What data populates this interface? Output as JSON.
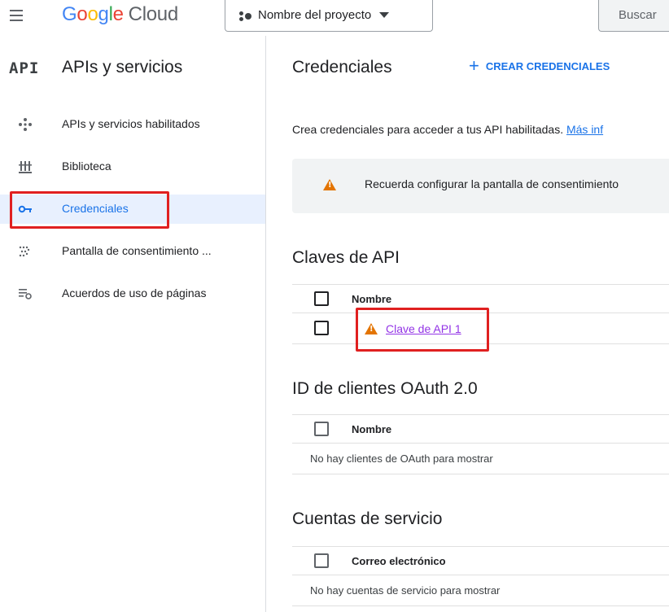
{
  "header": {
    "logo": {
      "google_letters": [
        "G",
        "o",
        "o",
        "g",
        "l",
        "e"
      ],
      "cloud_word": "Cloud"
    },
    "project_picker_label": "Nombre del proyecto",
    "search_placeholder": "Buscar",
    "icons": {
      "menu": "hamburger-menu-icon",
      "project": "project-nodes-icon",
      "caret": "caret-down-icon"
    }
  },
  "sidebar": {
    "badge": "API",
    "title": "APIs y servicios",
    "items": [
      {
        "label": "APIs y servicios habilitados",
        "icon": "dashboard-diamond-icon",
        "active": false
      },
      {
        "label": "Biblioteca",
        "icon": "library-icon",
        "active": false
      },
      {
        "label": "Credenciales",
        "icon": "key-icon",
        "active": true
      },
      {
        "label": "Pantalla de consentimiento ...",
        "icon": "consent-dots-icon",
        "active": false
      },
      {
        "label": "Acuerdos de uso de páginas",
        "icon": "settings-list-icon",
        "active": false
      }
    ]
  },
  "main": {
    "title": "Credenciales",
    "create_button": "CREAR CREDENCIALES",
    "intro_text": "Crea credenciales para acceder a tus API habilitadas.",
    "intro_link": "Más inf",
    "warning_text": "Recuerda configurar la pantalla de consentimiento",
    "api_keys": {
      "title": "Claves de API",
      "column_name": "Nombre",
      "rows": [
        {
          "name": "Clave de API 1",
          "warning": true
        }
      ]
    },
    "oauth_clients": {
      "title": "ID de clientes OAuth 2.0",
      "column_name": "Nombre",
      "empty_text": "No hay clientes de OAuth para mostrar"
    },
    "service_accounts": {
      "title": "Cuentas de servicio",
      "column_email": "Correo electrónico",
      "empty_text": "No hay cuentas de servicio para mostrar"
    }
  },
  "colors": {
    "accent": "#1a73e8",
    "active_nav_bg": "#e8f0fe",
    "warning": "#e37400",
    "visited_link": "#9334e6",
    "highlight_box": "#e02020"
  }
}
